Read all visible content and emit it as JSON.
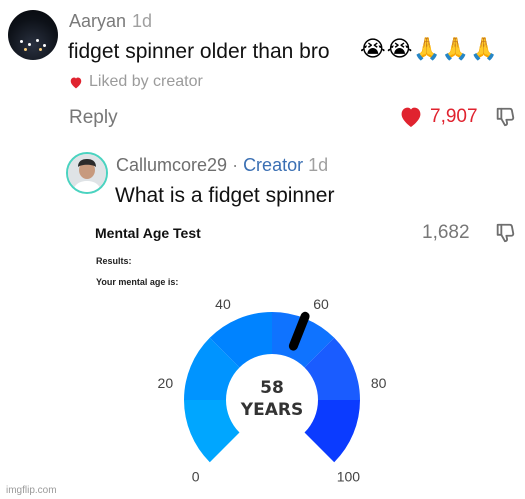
{
  "comment": {
    "username": "Aaryan",
    "time": "1d",
    "text": "fidget spinner older than bro",
    "emojis": "😭😭🙏🙏🙏",
    "liked_by": "Liked by creator",
    "reply_label": "Reply",
    "like_count": "7,907"
  },
  "reply": {
    "username": "Callumcore29",
    "separator": " · ",
    "creator_label": "Creator",
    "time": "1d",
    "text": "What is a fidget spinner"
  },
  "mental_age_test": {
    "title": "Mental Age Test",
    "count": "1,682",
    "results_label": "Results:",
    "age_label": "Your mental age is:",
    "value_number": "58",
    "value_unit": "YEARS",
    "value": 58,
    "min": 0,
    "max": 100,
    "ticks": [
      "0",
      "20",
      "40",
      "60",
      "80",
      "100"
    ],
    "colors": [
      "#00a6ff",
      "#0094ff",
      "#0083ff",
      "#0f73ff",
      "#1a5cff",
      "#0b3bff"
    ]
  },
  "watermark": "imgflip.com",
  "colors": {
    "heart": "#e0232f",
    "creator": "#3a6fb3",
    "needle": "#000000"
  }
}
